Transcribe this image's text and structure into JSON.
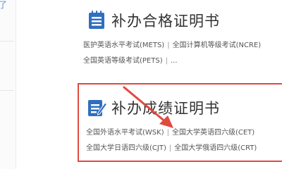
{
  "left_fragment": "了",
  "cards": [
    {
      "title": "补办合格证明书",
      "links_row1": [
        "医护英语水平考试(METS)",
        "全国计算机等级考试(NCRE)"
      ],
      "links_row2": [
        "全国英语等级考试(PETS)",
        "..."
      ]
    },
    {
      "title": "补办成绩证明书",
      "links_row1": [
        "全国外语水平考试(WSK)",
        "全国大学英语四六级(CET)"
      ],
      "links_row2": [
        "全国大学日语四六级(CJT)",
        "全国大学俄语四六级(CRT)"
      ]
    }
  ],
  "separator": "|",
  "colors": {
    "icon_blue": "#2f6fbf",
    "highlight_red": "#e04a3f"
  },
  "icons": [
    "certificate-list-icon",
    "certificate-edit-icon"
  ]
}
